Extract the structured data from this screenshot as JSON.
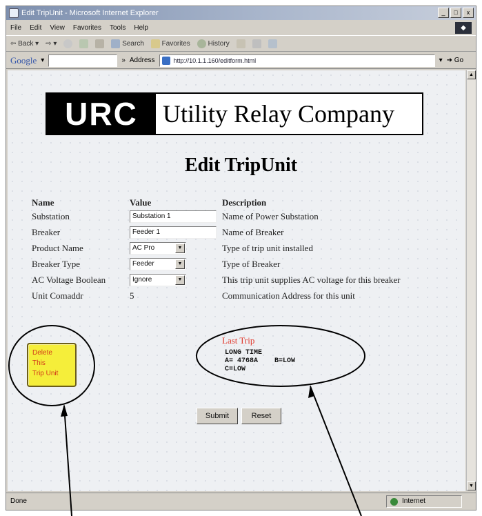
{
  "window": {
    "title": "Edit TripUnit - Microsoft Internet Explorer",
    "controls": [
      "_",
      "□",
      "x"
    ]
  },
  "menubar": {
    "items": [
      "File",
      "Edit",
      "View",
      "Favorites",
      "Tools",
      "Help"
    ]
  },
  "toolbar": {
    "back_label": "Back",
    "search_label": "Search",
    "favorites_label": "Favorites",
    "history_label": "History"
  },
  "addressbar": {
    "google_label": "Google",
    "address_label": "Address",
    "url": "http://10.1.1.160/editform.html",
    "go_label": "Go"
  },
  "logo": {
    "mark": "URC",
    "company": "Utility Relay Company"
  },
  "page": {
    "title": "Edit TripUnit"
  },
  "form": {
    "headers": {
      "name": "Name",
      "value": "Value",
      "description": "Description"
    },
    "rows": [
      {
        "name": "Substation",
        "value": "Substation 1",
        "description": "Name of Power Substation"
      },
      {
        "name": "Breaker",
        "value": "Feeder 1",
        "description": "Name of Breaker"
      },
      {
        "name": "Product Name",
        "value": "AC Pro",
        "description": "Type of trip unit installed"
      },
      {
        "name": "Breaker Type",
        "value": "Feeder",
        "description": "Type of Breaker"
      },
      {
        "name": "AC Voltage Boolean",
        "value": "Ignore",
        "description": "This trip unit supplies AC voltage for this breaker"
      },
      {
        "name": "Unit Comaddr",
        "value": "5",
        "description": "Communication Address for this unit"
      }
    ]
  },
  "delete_button": {
    "line1": "Delete",
    "line2": "This",
    "line3": "Trip Unit"
  },
  "last_trip": {
    "label": "Last Trip",
    "line1": "LONG TIME",
    "line2": "A= 4768A    B=LOW",
    "line3": "C=LOW"
  },
  "buttons": {
    "submit": "Submit",
    "reset": "Reset"
  },
  "statusbar": {
    "left": "Done",
    "zone": "Internet"
  },
  "icons": {
    "app": "ie-icon",
    "back": "back-arrow-icon",
    "forward": "forward-arrow-icon",
    "stop": "stop-icon",
    "refresh": "refresh-icon",
    "home": "home-icon",
    "search": "search-icon",
    "favorites": "favorites-icon",
    "history": "history-icon",
    "mail": "mail-icon",
    "print": "print-icon",
    "edit": "edit-icon",
    "go": "go-arrow-icon",
    "zone": "globe-icon"
  }
}
